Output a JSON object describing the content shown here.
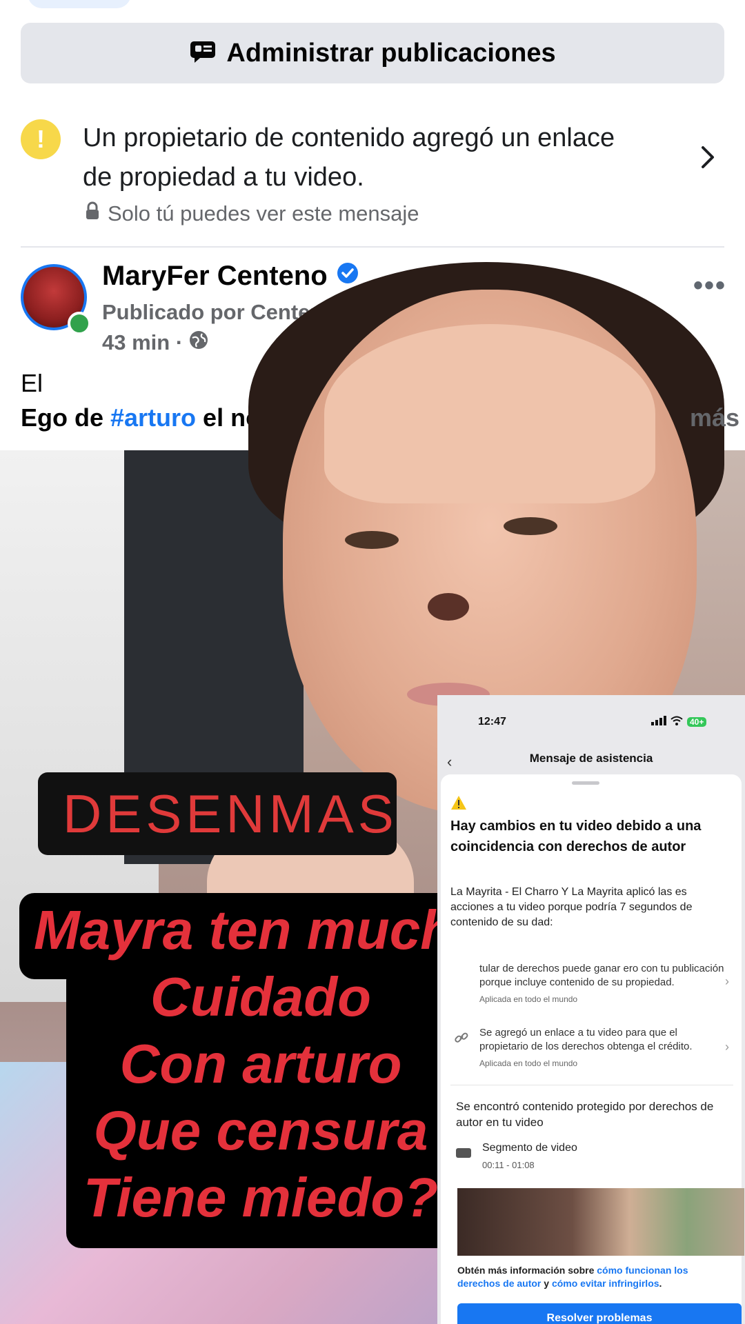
{
  "header": {
    "manage_posts_label": "Administrar publicaciones"
  },
  "notice": {
    "text": "Un propietario de contenido agregó un enlace de propiedad a tu video.",
    "privacy": "Solo tú puedes ver este mensaje"
  },
  "post": {
    "author": "MaryFer Centeno",
    "posted_by": "Publicado por Centeno Ma",
    "time": "43 min ·",
    "caption_line1": "El",
    "caption_prefix": "Ego de ",
    "hashtag": "#arturo",
    "caption_suffix": " el novi",
    "see_more": "más"
  },
  "video": {
    "overlay_sign": "DESENMAS",
    "caption_lines": [
      "Mayra ten mucho",
      "Cuidado",
      "Con arturo",
      "Que censura",
      "Tiene miedo?"
    ]
  },
  "screenshot": {
    "time": "12:47",
    "battery": "40+",
    "title": "Mensaje de asistencia",
    "heading": "Hay cambios en tu video debido a una coincidencia con derechos de autor",
    "body": "La Mayrita - El Charro Y La Mayrita aplicó las es acciones a tu video porque podría 7 segundos de contenido de su dad:",
    "item1_text": "tular de derechos puede ganar ero con tu publicación porque incluye contenido de su propiedad.",
    "item1_scope": "Aplicada en todo el mundo",
    "item2_text": "Se agregó un enlace a tu video para que el propietario de los derechos obtenga el crédito.",
    "item2_scope": "Aplicada en todo el mundo",
    "found_text": "Se encontró contenido protegido por derechos de autor en tu video",
    "segment_label": "Segmento de video",
    "segment_time": "00:11 - 01:08",
    "info_prefix": "Obtén más información sobre ",
    "info_link1": "cómo funcionan los derechos de autor",
    "info_mid": " y ",
    "info_link2": "cómo evitar infringirlos",
    "info_suffix": ".",
    "button": "Resolver problemas"
  }
}
